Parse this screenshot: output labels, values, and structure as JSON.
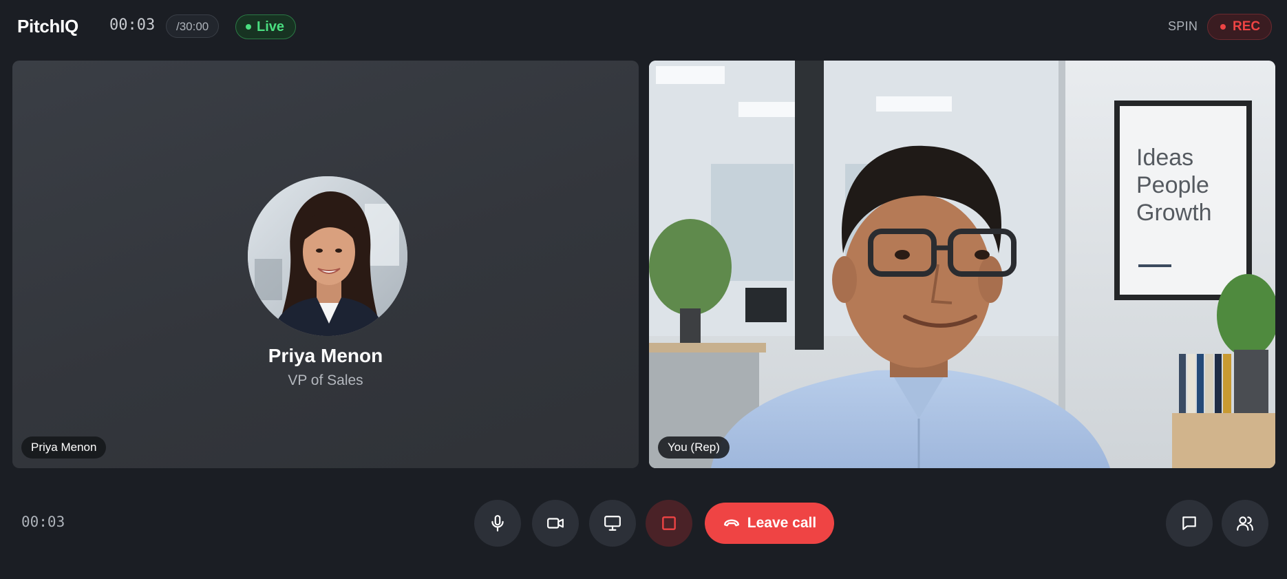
{
  "header": {
    "brand": "PitchIQ",
    "timer": "00:03",
    "limit": "/30:00",
    "live_label": "Live",
    "mode_label": "SPIN",
    "rec_label": "REC"
  },
  "tiles": {
    "prospect": {
      "name": "Priya Menon",
      "role": "VP of Sales",
      "tag": "Priya Menon"
    },
    "self": {
      "tag": "You (Rep)",
      "poster_text": [
        "Ideas",
        "People",
        "Growth"
      ]
    }
  },
  "controls": {
    "elapsed": "00:03",
    "leave_label": "Leave call",
    "icons": [
      "microphone-icon",
      "camera-icon",
      "screen-share-icon",
      "stop-icon",
      "phone-hangup-icon",
      "chat-icon",
      "participants-icon"
    ]
  },
  "colors": {
    "background": "#1b1e24",
    "live_green": "#4ade80",
    "rec_red": "#ef4444",
    "leave_red": "#ef4444"
  }
}
